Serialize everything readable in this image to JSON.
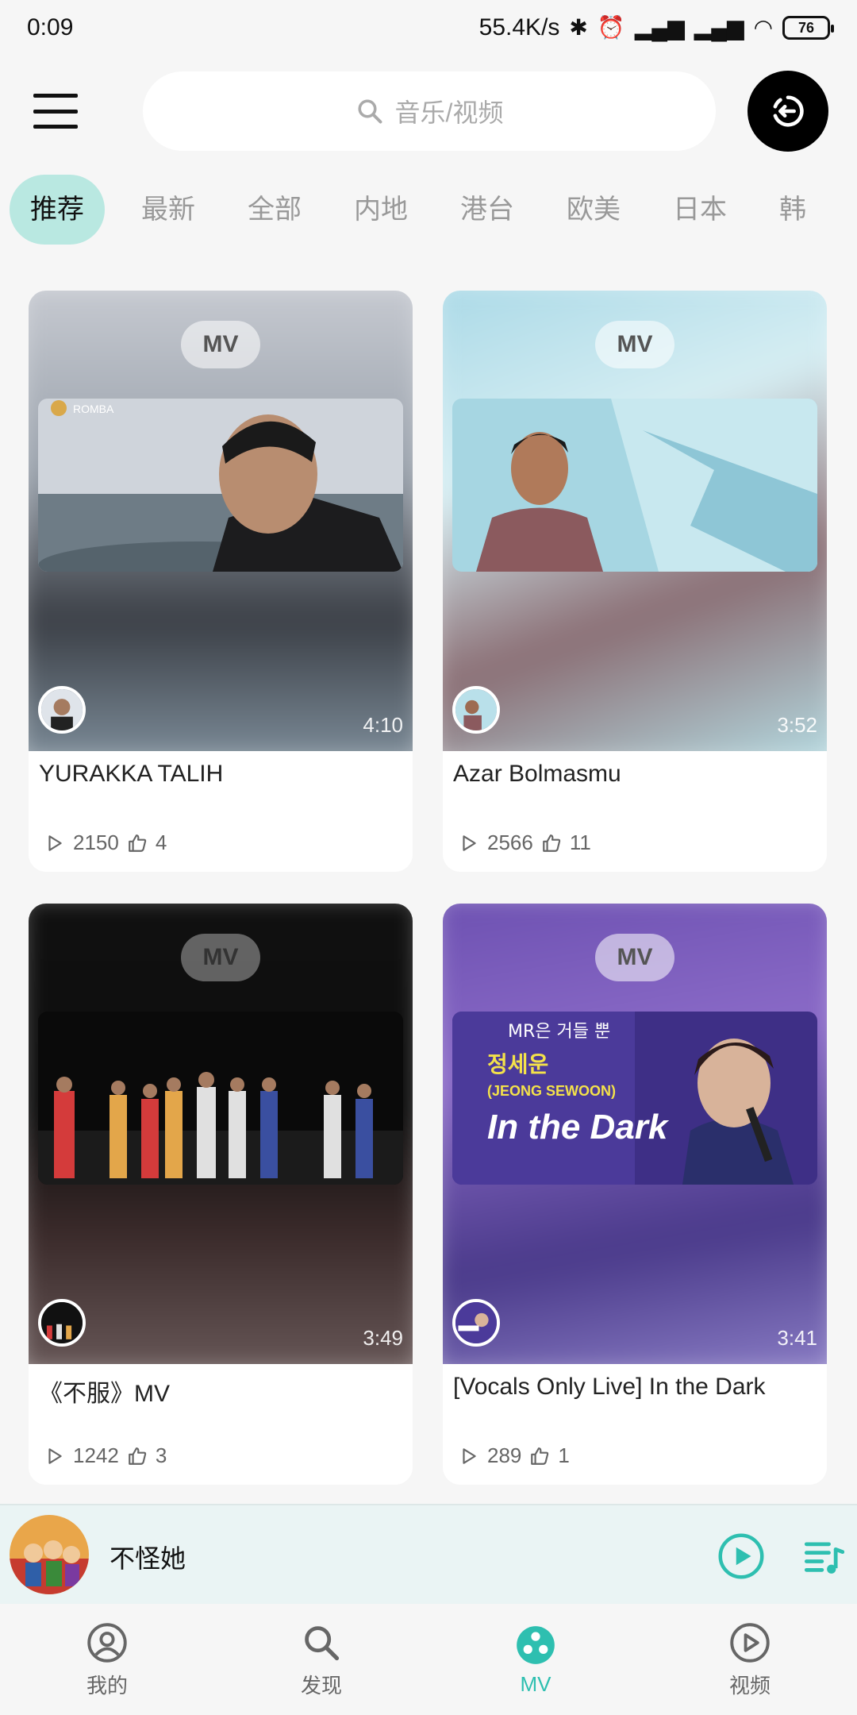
{
  "status_bar": {
    "time": "0:09",
    "net_speed": "55.4K/s",
    "battery": "76"
  },
  "header": {
    "search_placeholder": "音乐/视频"
  },
  "tabs": [
    "推荐",
    "最新",
    "全部",
    "内地",
    "港台",
    "欧美",
    "日本",
    "韩"
  ],
  "mv_badge": "MV",
  "cards": [
    {
      "title": "YURAKKA TALIH",
      "duration": "4:10",
      "plays": "2150",
      "likes": "4"
    },
    {
      "title": "Azar Bolmasmu",
      "duration": "3:52",
      "plays": "2566",
      "likes": "11"
    },
    {
      "title": "《不服》MV",
      "duration": "3:49",
      "plays": "1242",
      "likes": "3"
    },
    {
      "title": "[Vocals Only Live] In the Dark",
      "duration": "3:41",
      "plays": "289",
      "likes": "1"
    }
  ],
  "thumb_text": {
    "logo": "ROMBA",
    "korean_top": "MR은 거들 뿐",
    "korean_name": "정세운",
    "english_name": "(JEONG SEWOON)",
    "song": "In the Dark"
  },
  "mini_player": {
    "title": "不怪她"
  },
  "bottom_nav": [
    {
      "label": "我的",
      "icon": "profile-icon"
    },
    {
      "label": "发现",
      "icon": "search-icon"
    },
    {
      "label": "MV",
      "icon": "mv-icon"
    },
    {
      "label": "视频",
      "icon": "video-play-icon"
    }
  ],
  "colors": {
    "accent": "#2ebfb0",
    "tab_active_bg": "#b9e8e1",
    "background": "#f6f6f6"
  }
}
